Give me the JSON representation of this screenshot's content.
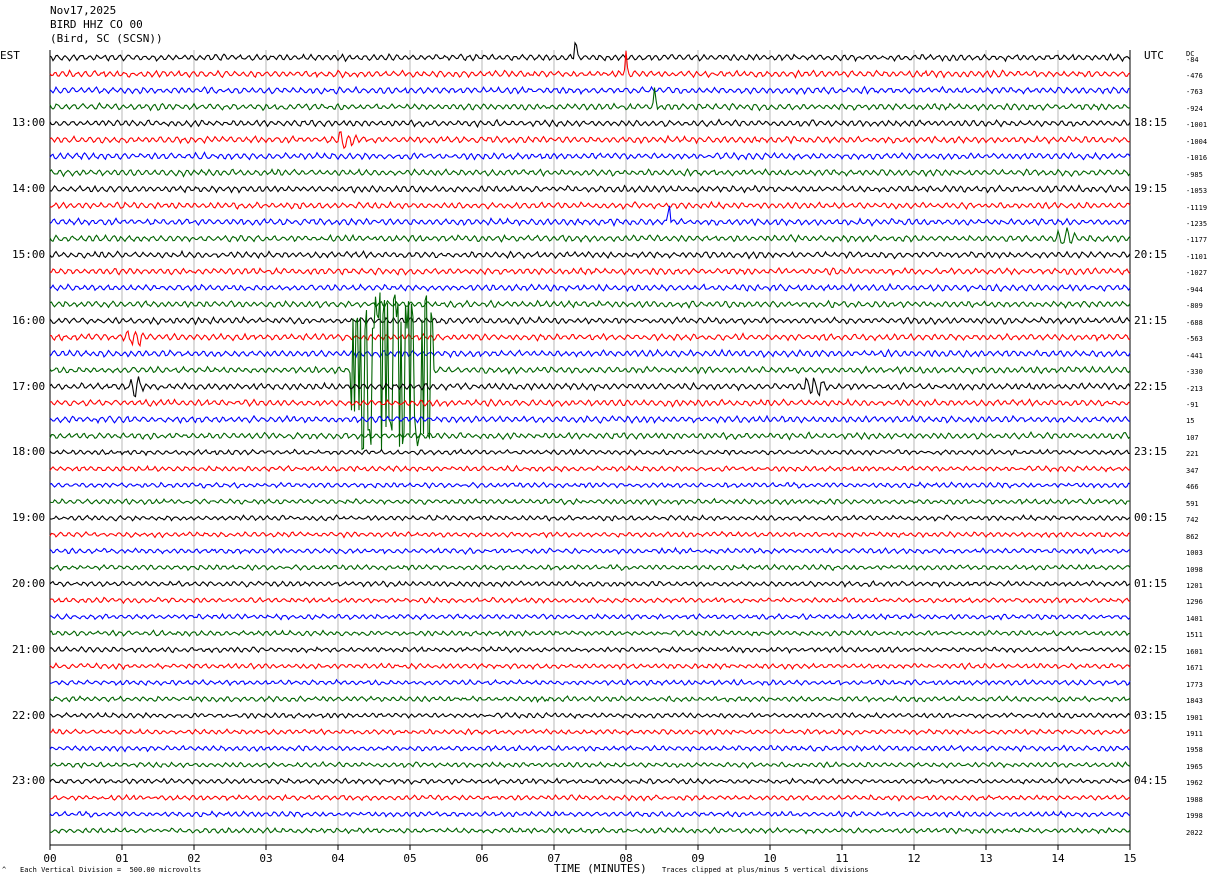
{
  "header": {
    "date": "Nov17,2025",
    "station": "BIRD HHZ CO 00",
    "location": "(Bird, SC (SCSN))"
  },
  "left_timezone": "EST",
  "right_timezone": "UTC",
  "dc_label": "DC",
  "footer": {
    "scale_note": "Each Vertical Division =  500.00 microvolts",
    "clip_note": "Traces clipped at plus/minus 5 vertical divisions",
    "corner_mark": "^"
  },
  "colors": {
    "trace_cycle": [
      "#000000",
      "#ff0000",
      "#0000ff",
      "#006400"
    ],
    "grid": "#888888"
  },
  "chart_data": {
    "type": "line",
    "title": "Nov17,2025 BIRD HHZ CO 00 (Bird, SC (SCSN))",
    "xlabel": "TIME (MINUTES)",
    "ylabel": "",
    "x_ticks": [
      "00",
      "01",
      "02",
      "03",
      "04",
      "05",
      "06",
      "07",
      "08",
      "09",
      "10",
      "11",
      "12",
      "13",
      "14",
      "15"
    ],
    "xlim": [
      0,
      15
    ],
    "left_hour_labels": [
      "13:00",
      "14:00",
      "15:00",
      "16:00",
      "17:00",
      "18:00",
      "19:00",
      "20:00",
      "21:00",
      "22:00",
      "23:00"
    ],
    "right_hour_labels": [
      "18:15",
      "19:15",
      "20:15",
      "21:15",
      "22:15",
      "23:15",
      "00:15",
      "01:15",
      "02:15",
      "03:15",
      "04:15"
    ],
    "trace_dc_offsets": [
      -84,
      -476,
      -763,
      -924,
      -1001,
      -1004,
      -1016,
      -985,
      -1053,
      -1119,
      -1235,
      -1177,
      -1101,
      -1027,
      -944,
      -809,
      -688,
      -563,
      -441,
      -330,
      -213,
      -91,
      15,
      107,
      221,
      347,
      466,
      591,
      742,
      862,
      1003,
      1098,
      1201,
      1296,
      1401,
      1511,
      1601,
      1671,
      1773,
      1843,
      1901,
      1911,
      1958,
      1965,
      1962,
      1988,
      1998,
      2022
    ],
    "trace_count": 48,
    "minutes_per_trace": 15,
    "vertical_division_microvolts": 500,
    "clip_divisions": 5,
    "grid": true,
    "events": [
      {
        "trace": 0,
        "minute": 7.3,
        "note": "spike"
      },
      {
        "trace": 1,
        "minute": 8.0,
        "note": "spike"
      },
      {
        "trace": 3,
        "minute": 8.4,
        "note": "spike"
      },
      {
        "trace": 5,
        "minute": 4.1,
        "note": "burst"
      },
      {
        "trace": 10,
        "minute": 8.6,
        "note": "spike"
      },
      {
        "trace": 11,
        "minute": 14.1,
        "note": "burst"
      },
      {
        "trace": 17,
        "minute": 1.2,
        "note": "burst"
      },
      {
        "trace": 19,
        "minute": 4.5,
        "note": "clipped"
      },
      {
        "trace": 19,
        "minute": 5.0,
        "note": "clipped"
      },
      {
        "trace": 20,
        "minute": 1.2,
        "note": "burst"
      },
      {
        "trace": 20,
        "minute": 10.6,
        "note": "burst"
      }
    ]
  }
}
